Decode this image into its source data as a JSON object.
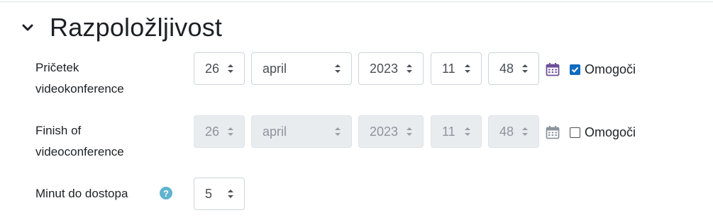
{
  "section": {
    "title": "Razpoložljivost",
    "collapse_icon": "chevron-down-icon"
  },
  "start": {
    "label_line1": "Pričetek",
    "label_line2": "videokonference",
    "day": "26",
    "month": "april",
    "year": "2023",
    "hour": "11",
    "minute": "48",
    "enabled": true,
    "enable_label": "Omogoči"
  },
  "finish": {
    "label_line1": "Finish of",
    "label_line2": "videoconference",
    "day": "26",
    "month": "april",
    "year": "2023",
    "hour": "11",
    "minute": "48",
    "enabled": false,
    "enable_label": "Omogoči"
  },
  "minutes": {
    "label": "Minut do dostopa",
    "value": "5",
    "help_icon": "question-circle-icon"
  },
  "colors": {
    "accent": "#0f6cbf",
    "help": "#5fb3ce",
    "disabled_bg": "#e9ecef",
    "calendar": "#6c4f99"
  }
}
